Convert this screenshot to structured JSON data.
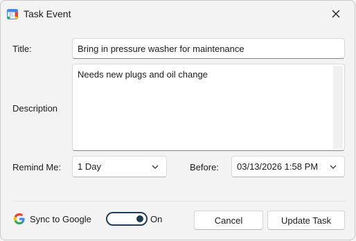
{
  "window": {
    "title": "Task Event",
    "app_icon": "calendar-icon",
    "close_icon": "close-icon"
  },
  "form": {
    "title_label": "Title:",
    "title_value": "Bring in pressure washer for maintenance",
    "description_label": "Description",
    "description_value": "Needs new plugs and oil change",
    "remind_label": "Remind Me:",
    "remind_value": "1 Day",
    "before_label": "Before:",
    "before_value": "03/13/2026 1:58 PM"
  },
  "footer": {
    "sync_icon": "google-icon",
    "sync_label": "Sync to Google",
    "toggle_state": "On",
    "cancel_label": "Cancel",
    "update_label": "Update Task"
  },
  "colors": {
    "toggle_accent": "#1f3c57",
    "background": "#f3f3f3"
  }
}
